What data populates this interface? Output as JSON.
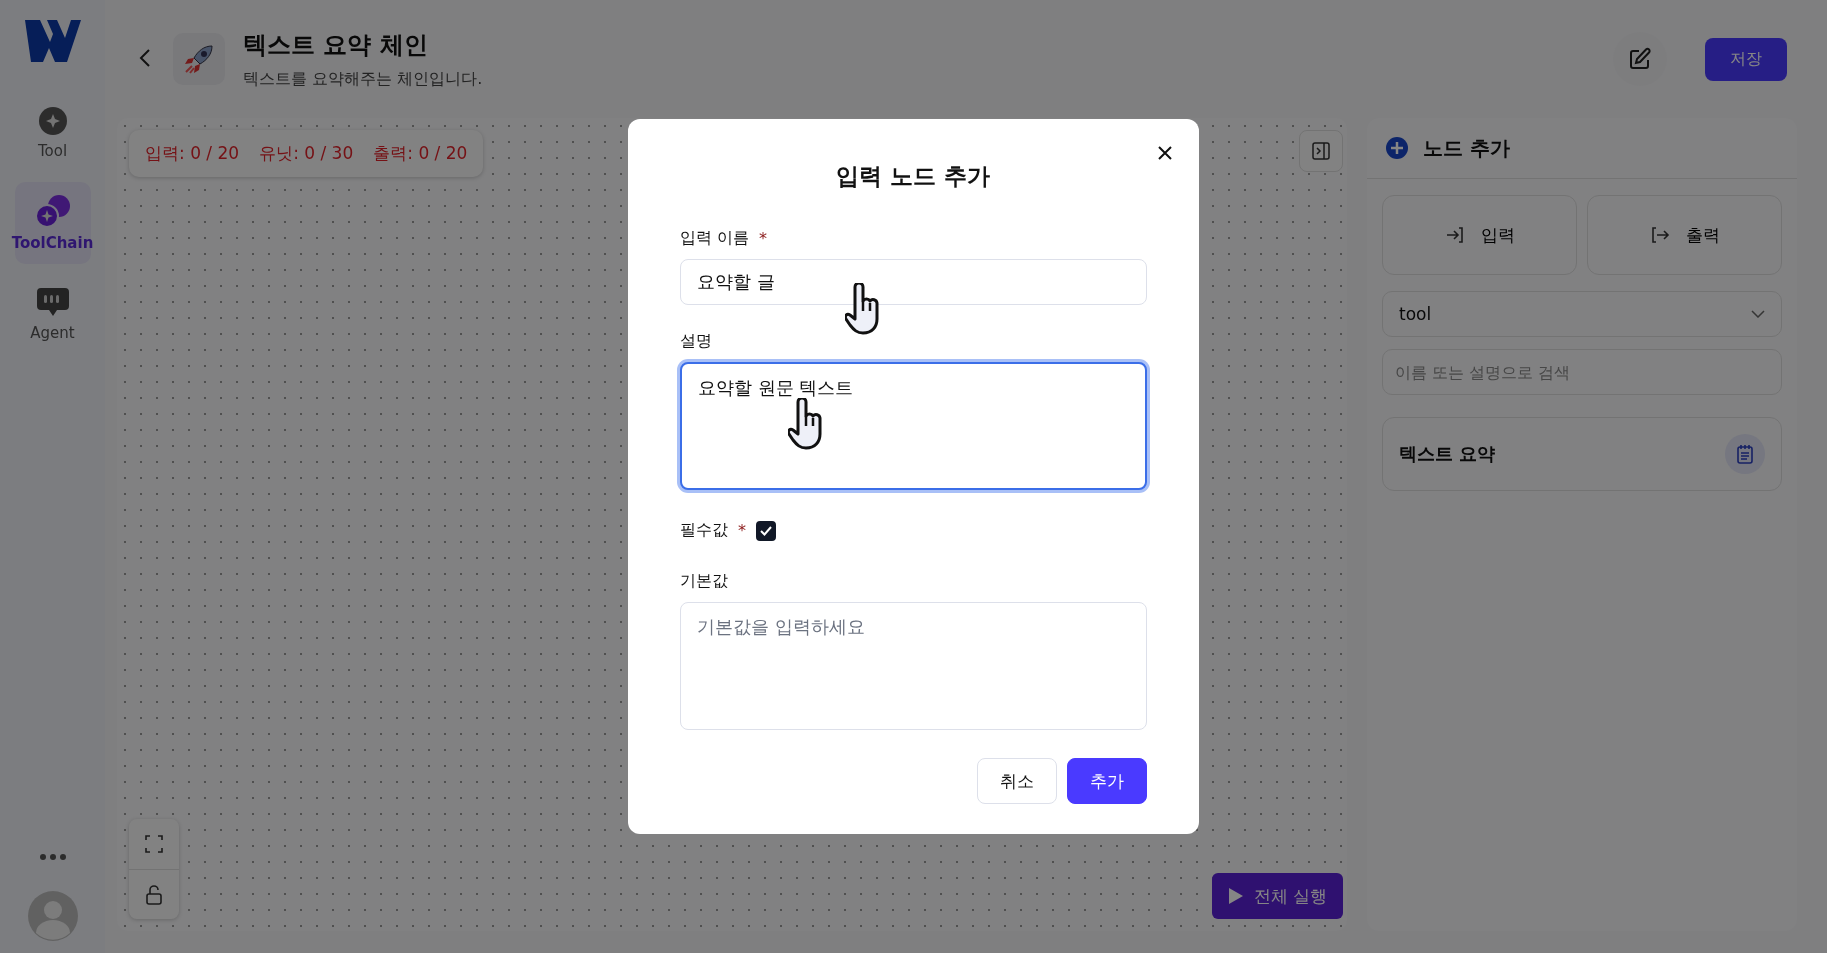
{
  "sidebar": {
    "items": [
      {
        "label": "Tool",
        "kind": "tool",
        "selected": false
      },
      {
        "label": "ToolChain",
        "kind": "chain",
        "selected": true
      },
      {
        "label": "Agent",
        "kind": "agent",
        "selected": false
      }
    ]
  },
  "header": {
    "title": "텍스트 요약 체인",
    "subtitle": "텍스트를 요약해주는 체인입니다.",
    "save_button": "저장"
  },
  "canvas": {
    "counters": [
      {
        "label": "입력: 0 / 20"
      },
      {
        "label": "유닛: 0 / 30"
      },
      {
        "label": "출력: 0 / 20"
      }
    ],
    "run_button": "전체 실행"
  },
  "panel": {
    "title": "노드 추가",
    "node_buttons": [
      {
        "label": "입력",
        "kind": "input"
      },
      {
        "label": "출력",
        "kind": "output"
      }
    ],
    "category_select": {
      "value": "tool"
    },
    "search": {
      "placeholder": "이름 또는 설명으로 검색"
    },
    "tools": [
      {
        "name": "텍스트 요약"
      }
    ]
  },
  "dialog": {
    "title": "입력 노드 추가",
    "fields": [
      {
        "kind": "text",
        "label": "입력 이름",
        "required_mark": "*",
        "value": "요약할 글",
        "focused": false
      },
      {
        "kind": "textarea",
        "label": "설명",
        "value": "요약할 원문 텍스트",
        "focused": true
      },
      {
        "kind": "checkbox",
        "label": "필수값",
        "required_mark": "*",
        "checked": true
      },
      {
        "kind": "textarea",
        "label": "기본값",
        "placeholder": "기본값을 입력하세요",
        "focused": false
      }
    ],
    "buttons": [
      {
        "label": "취소",
        "kind": "secondary"
      },
      {
        "label": "추가",
        "kind": "primary"
      }
    ]
  }
}
